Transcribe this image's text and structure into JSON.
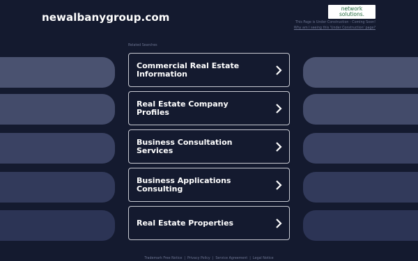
{
  "header": {
    "domain": "newalbanygroup.com",
    "logo_line1": "network",
    "logo_line2": "solutions.",
    "under_construction": "This Page is Under Construction - Coming Soon!",
    "why_link": "Why am I seeing this 'Under Construction' page?"
  },
  "related": {
    "heading": "Related Searches",
    "items": [
      {
        "label": "Commercial Real Estate Information"
      },
      {
        "label": "Real Estate Company Profiles"
      },
      {
        "label": "Business Consultation Services"
      },
      {
        "label": "Business Applications Consulting"
      },
      {
        "label": "Real Estate Properties"
      }
    ]
  },
  "side_panels": {
    "colors": [
      "#4a5270",
      "#434b6a",
      "#3a4263",
      "#323a5b",
      "#2c3455"
    ]
  },
  "footer": {
    "links": [
      "Trademark Free Notice",
      "Privacy Policy",
      "Service Agreement",
      "Legal Notice"
    ]
  }
}
